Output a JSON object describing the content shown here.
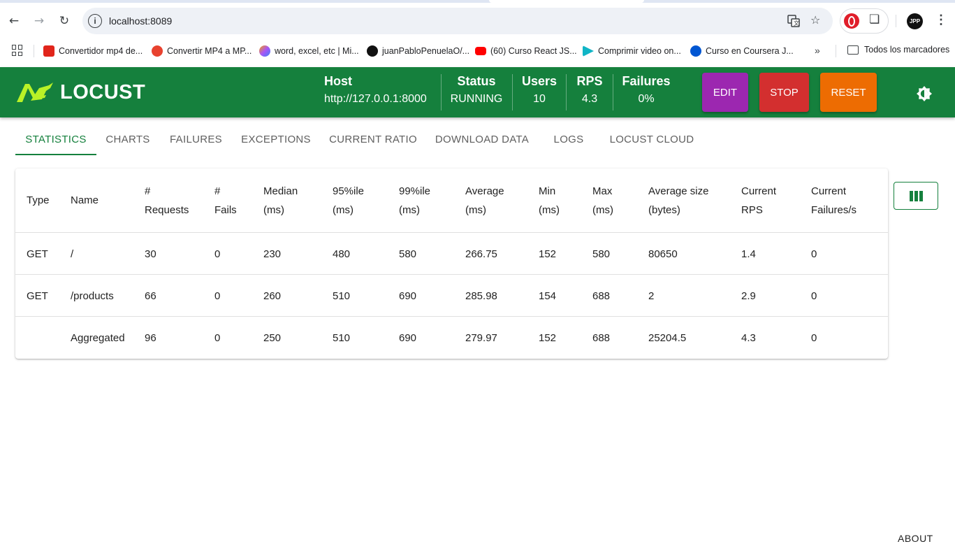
{
  "browser": {
    "url": "localhost:8089",
    "bookmarks": [
      {
        "label": "Convertidor mp4 de...",
        "color": "#e1251b"
      },
      {
        "label": "Convertir MP4 a MP...",
        "color": "#e8422f"
      },
      {
        "label": "word, excel, etc | Mi...",
        "color": "#a855f7"
      },
      {
        "label": "juanPabloPenuelaO/...",
        "color": "#111111"
      },
      {
        "label": "(60) Curso React JS...",
        "color": "#ff0000"
      },
      {
        "label": "Comprimir video on...",
        "color": "#10b5c6"
      },
      {
        "label": "Curso en Coursera J...",
        "color": "#0056d2"
      }
    ],
    "all_bookmarks_label": "Todos los marcadores",
    "avatar_initials": "JPP"
  },
  "header": {
    "logo_text": "LOCUST",
    "host_label": "Host",
    "host_value": "http://127.0.0.1:8000",
    "status_label": "Status",
    "status_value": "RUNNING",
    "users_label": "Users",
    "users_value": "10",
    "rps_label": "RPS",
    "rps_value": "4.3",
    "failures_label": "Failures",
    "failures_value": "0%",
    "edit_label": "EDIT",
    "stop_label": "STOP",
    "reset_label": "RESET",
    "colors": {
      "bar": "#15803d",
      "edit": "#9c27b0",
      "stop": "#d32f2f",
      "reset": "#ed6c02"
    }
  },
  "tabs": [
    "STATISTICS",
    "CHARTS",
    "FAILURES",
    "EXCEPTIONS",
    "CURRENT RATIO",
    "DOWNLOAD DATA",
    "LOGS",
    "LOCUST CLOUD"
  ],
  "table": {
    "headers": [
      "Type",
      "Name",
      "#\nRequests",
      "#\nFails",
      "Median\n(ms)",
      "95%ile\n(ms)",
      "99%ile\n(ms)",
      "Average\n(ms)",
      "Min\n(ms)",
      "Max\n(ms)",
      "Average size\n(bytes)",
      "Current\nRPS",
      "Current\nFailures/s"
    ],
    "rows": [
      [
        "GET",
        "/",
        "30",
        "0",
        "230",
        "480",
        "580",
        "266.75",
        "152",
        "580",
        "80650",
        "1.4",
        "0"
      ],
      [
        "GET",
        "/products",
        "66",
        "0",
        "260",
        "510",
        "690",
        "285.98",
        "154",
        "688",
        "2",
        "2.9",
        "0"
      ],
      [
        "",
        "Aggregated",
        "96",
        "0",
        "250",
        "510",
        "690",
        "279.97",
        "152",
        "688",
        "25204.5",
        "4.3",
        "0"
      ]
    ]
  },
  "footer": {
    "about_label": "ABOUT"
  }
}
